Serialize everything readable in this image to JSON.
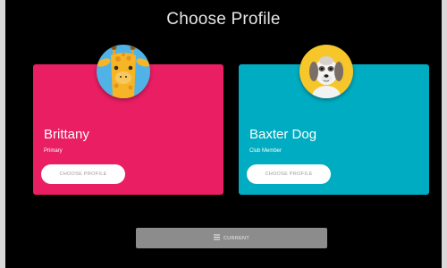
{
  "screen": {
    "title": "Choose Profile"
  },
  "profiles": [
    {
      "name": "Brittany",
      "role": "Primary",
      "button_label": "CHOOSE PROFILE",
      "card_color": "#e91e63",
      "avatar_icon": "giraffe-avatar-icon"
    },
    {
      "name": "Baxter Dog",
      "role": "Club Member",
      "button_label": "CHOOSE PROFILE",
      "card_color": "#00acc1",
      "avatar_icon": "dog-avatar-icon"
    }
  ],
  "footer": {
    "current_label": "CURRENT",
    "current_icon": "list-icon"
  }
}
